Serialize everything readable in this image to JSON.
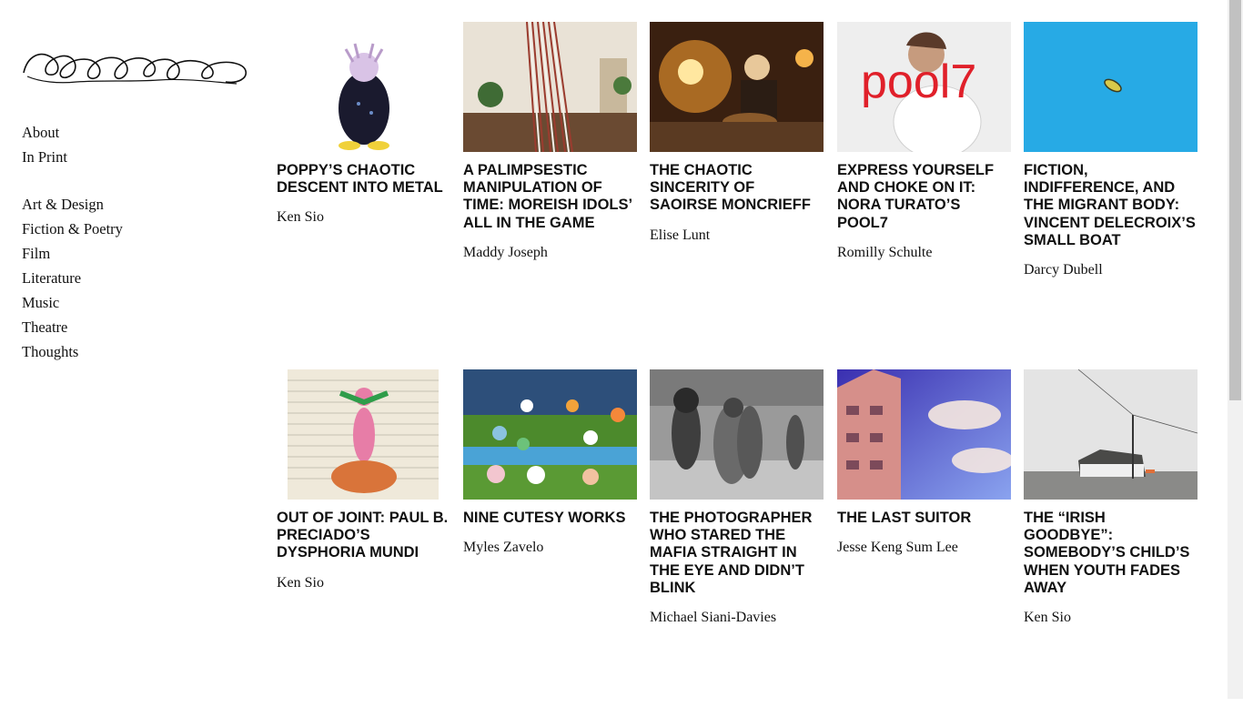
{
  "site": {
    "logo_icon": "orla-wordmark-logo"
  },
  "nav": {
    "primary": [
      "About",
      "In Print"
    ],
    "sections": [
      "Art & Design",
      "Fiction & Poetry",
      "Film",
      "Literature",
      "Music",
      "Theatre",
      "Thoughts"
    ]
  },
  "articles": [
    {
      "title": "POPPY’S CHAOTIC DESCENT INTO METAL",
      "author": "Ken Sio",
      "thumb_icon": "illustrated-figure-image"
    },
    {
      "title": "A PALIMPSESTIC MANIPULATION OF TIME: MOREISH IDOLS’ ALL IN THE GAME",
      "author": "Maddy Joseph",
      "thumb_icon": "room-interior-photo"
    },
    {
      "title": "THE CHAOTIC SINCERITY OF SAOIRSE MONCRIEFF",
      "author": "Elise Lunt",
      "thumb_icon": "candlelit-guitarist-photo"
    },
    {
      "title": "EXPRESS YOURSELF AND CHOKE ON IT: NORA TURATO’S POOL7",
      "author": "Romilly Schulte",
      "thumb_icon": "pool7-cover-photo",
      "thumb_text": "pool7"
    },
    {
      "title": "FICTION, INDIFFERENCE, AND THE MIGRANT BODY: VINCENT DELECROIX’S SMALL BOAT",
      "author": "Darcy Dubell",
      "thumb_icon": "boat-on-sea-photo"
    },
    {
      "title": "OUT OF JOINT: PAUL B. PRECIADO’S DYSPHORIA MUNDI",
      "author": "Ken Sio",
      "thumb_icon": "notebook-drawing-image"
    },
    {
      "title": "NINE CUTESY WORKS",
      "author": "Myles Zavelo",
      "thumb_icon": "toy-animals-photo"
    },
    {
      "title": "THE PHOTOGRAPHER WHO STARED THE MAFIA STRAIGHT IN THE EYE AND DIDN’T BLINK",
      "author": "Michael Siani-Davies",
      "thumb_icon": "beach-crowd-bw-photo"
    },
    {
      "title": "THE LAST SUITOR",
      "author": "Jesse Keng Sum Lee",
      "thumb_icon": "building-sky-photo"
    },
    {
      "title": "THE “IRISH GOODBYE”: SOMEBODY’S CHILD’S WHEN YOUTH FADES AWAY",
      "author": "Ken Sio",
      "thumb_icon": "coastal-house-photo"
    }
  ]
}
